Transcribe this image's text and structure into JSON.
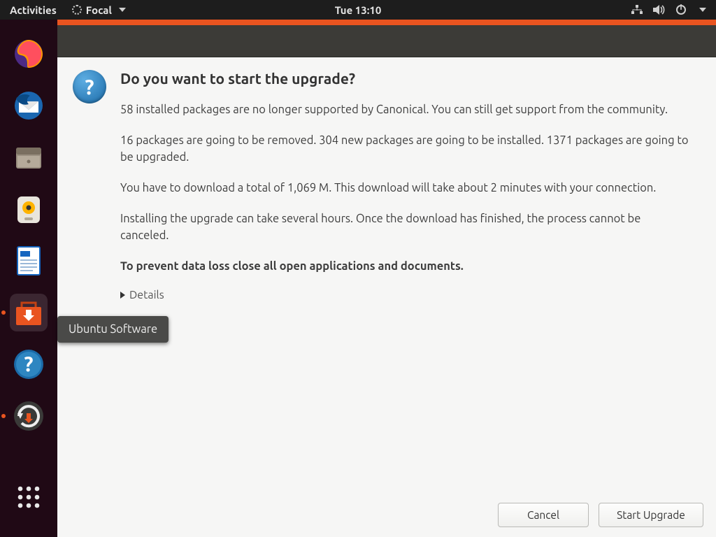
{
  "topbar": {
    "activities": "Activities",
    "app_name": "Focal",
    "clock": "Tue 13:10"
  },
  "tooltip": {
    "label": "Ubuntu Software"
  },
  "dialog": {
    "heading": "Do you want to start the upgrade?",
    "p1": "58 installed packages are no longer supported by Canonical. You can still get support from the community.",
    "p2": "16 packages are going to be removed. 304 new packages are going to be installed. 1371 packages are going to be upgraded.",
    "p3": "You have to download a total of 1,069 M. This download will take about 2 minutes with your connection.",
    "p4": "Installing the upgrade can take several hours. Once the download has finished, the process cannot be canceled.",
    "p5": "To prevent data loss close all open applications and documents.",
    "details_label": "Details",
    "cancel": "Cancel",
    "start": "Start Upgrade"
  }
}
